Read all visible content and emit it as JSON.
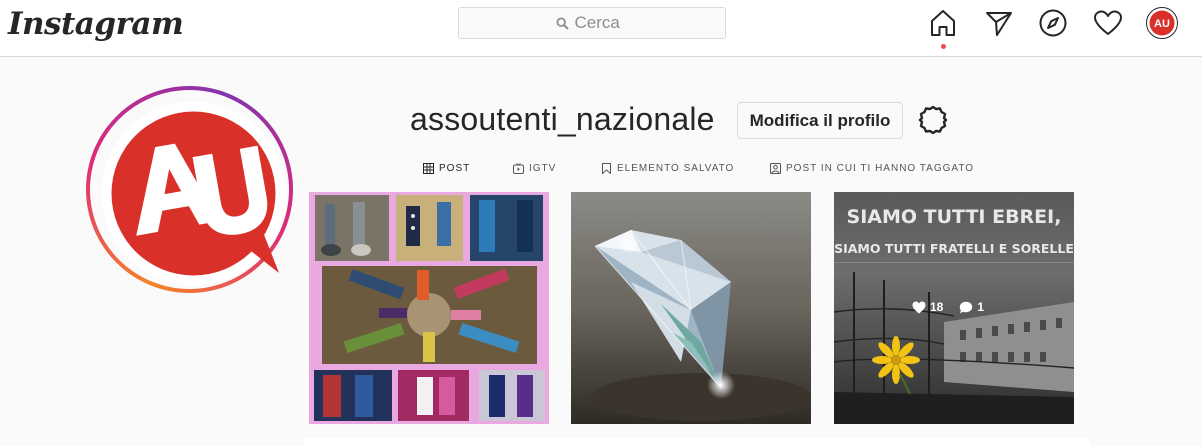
{
  "app": {
    "logo_text": "Instagram"
  },
  "search": {
    "placeholder": "Cerca"
  },
  "nav": {
    "icons": [
      "home-icon",
      "direct-icon",
      "explore-icon",
      "activity-heart-icon",
      "profile-avatar-icon"
    ],
    "active": "home",
    "active_color": "#ed4956"
  },
  "profile": {
    "username": "assoutenti_nazionale",
    "edit_label": "Modifica il profilo",
    "avatar_text": "AU",
    "avatar_color": "#d9302a"
  },
  "tabs": [
    {
      "label": "POST",
      "icon": "grid-icon",
      "active": true
    },
    {
      "label": "IGTV",
      "icon": "igtv-icon",
      "active": false
    },
    {
      "label": "ELEMENTO SALVATO",
      "icon": "bookmark-icon",
      "active": false
    },
    {
      "label": "POST IN CUI TI HANNO TAGGATO",
      "icon": "tagged-icon",
      "active": false
    }
  ],
  "posts": [
    {
      "name": "socks-collage-post"
    },
    {
      "name": "diamond-post"
    },
    {
      "name": "memorial-post",
      "caption_line1": "SIAMO TUTTI EBREI,",
      "caption_line2": "SIAMO TUTTI FRATELLI E SORELLE",
      "likes": "18",
      "comments": "1"
    }
  ]
}
